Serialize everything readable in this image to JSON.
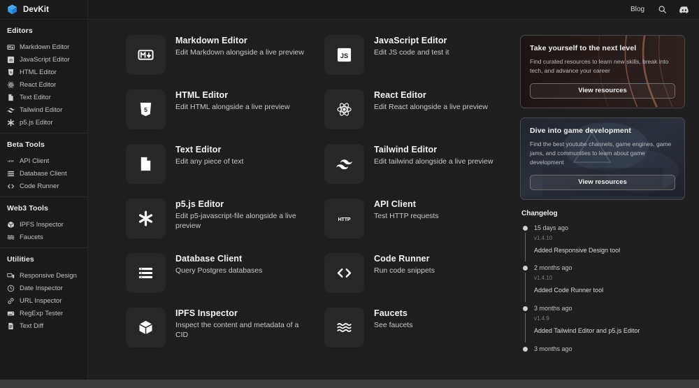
{
  "app": {
    "name": "DevKit",
    "logo_icon": "code-cube-logo-icon"
  },
  "topbar": {
    "blog_label": "Blog",
    "search_icon": "search-icon",
    "discord_icon": "discord-icon"
  },
  "sidebar": {
    "groups": [
      {
        "title": "Editors",
        "items": [
          {
            "label": "Markdown Editor",
            "icon": "markdown-icon"
          },
          {
            "label": "JavaScript Editor",
            "icon": "javascript-icon"
          },
          {
            "label": "HTML Editor",
            "icon": "html5-icon"
          },
          {
            "label": "React Editor",
            "icon": "react-icon"
          },
          {
            "label": "Text Editor",
            "icon": "document-icon"
          },
          {
            "label": "Tailwind Editor",
            "icon": "tailwind-icon"
          },
          {
            "label": "p5.js Editor",
            "icon": "asterisk-icon"
          }
        ]
      },
      {
        "title": "Beta Tools",
        "items": [
          {
            "label": "API Client",
            "icon": "http-icon"
          },
          {
            "label": "Database Client",
            "icon": "database-list-icon"
          },
          {
            "label": "Code Runner",
            "icon": "angle-brackets-icon"
          }
        ]
      },
      {
        "title": "Web3 Tools",
        "items": [
          {
            "label": "IPFS Inspector",
            "icon": "cube-icon"
          },
          {
            "label": "Faucets",
            "icon": "waves-icon"
          }
        ]
      },
      {
        "title": "Utilities",
        "items": [
          {
            "label": "Responsive Design",
            "icon": "devices-icon"
          },
          {
            "label": "Date Inspector",
            "icon": "clock-icon"
          },
          {
            "label": "URL Inspector",
            "icon": "link-icon"
          },
          {
            "label": "RegExp Tester",
            "icon": "regex-icon"
          },
          {
            "label": "Text Diff",
            "icon": "text-diff-icon"
          }
        ]
      }
    ]
  },
  "tools": [
    {
      "title": "Markdown Editor",
      "desc": "Edit Markdown alongside a live preview",
      "icon": "markdown-icon"
    },
    {
      "title": "JavaScript Editor",
      "desc": "Edit JS code and test it",
      "icon": "javascript-icon"
    },
    {
      "title": "HTML Editor",
      "desc": "Edit HTML alongside a live preview",
      "icon": "html5-icon"
    },
    {
      "title": "React Editor",
      "desc": "Edit React alongside a live preview",
      "icon": "react-icon"
    },
    {
      "title": "Text Editor",
      "desc": "Edit any piece of text",
      "icon": "document-icon"
    },
    {
      "title": "Tailwind Editor",
      "desc": "Edit tailwind alongside a live preview",
      "icon": "tailwind-icon"
    },
    {
      "title": "p5.js Editor",
      "desc": "Edit p5-javascript-file alongside a live preview",
      "icon": "asterisk-icon"
    },
    {
      "title": "API Client",
      "desc": "Test HTTP requests",
      "icon": "http-icon"
    },
    {
      "title": "Database Client",
      "desc": "Query Postgres databases",
      "icon": "database-list-icon"
    },
    {
      "title": "Code Runner",
      "desc": "Run code snippets",
      "icon": "angle-brackets-icon"
    },
    {
      "title": "IPFS Inspector",
      "desc": "Inspect the content and metadata of a CID",
      "icon": "cube-icon"
    },
    {
      "title": "Faucets",
      "desc": "See faucets",
      "icon": "waves-icon"
    }
  ],
  "promos": [
    {
      "title": "Take yourself to the next level",
      "desc": "Find curated resources to learn new skills, break into tech, and advance your career",
      "button": "View resources",
      "accent": "#8a5a4a"
    },
    {
      "title": "Dive into game development",
      "desc": "Find the best youtube channels, game engines, game jams, and communities to learn about game development",
      "button": "View resources",
      "accent": "#3d4a63"
    }
  ],
  "changelog": {
    "title": "Changelog",
    "entries": [
      {
        "when": "15 days ago",
        "version": "v1.4.10",
        "desc": "Added Responsive Design tool"
      },
      {
        "when": "2 months ago",
        "version": "v1.4.10",
        "desc": "Added Code Runner tool"
      },
      {
        "when": "3 months ago",
        "version": "v1.4.9",
        "desc": "Added Tailwind Editor and p5.js Editor"
      },
      {
        "when": "3 months ago",
        "version": "",
        "desc": ""
      }
    ]
  },
  "colors": {
    "background": "#1e1e1e",
    "sidebar": "#1a1a1a",
    "tile": "#272727",
    "brand_blue": "#2196f3"
  }
}
